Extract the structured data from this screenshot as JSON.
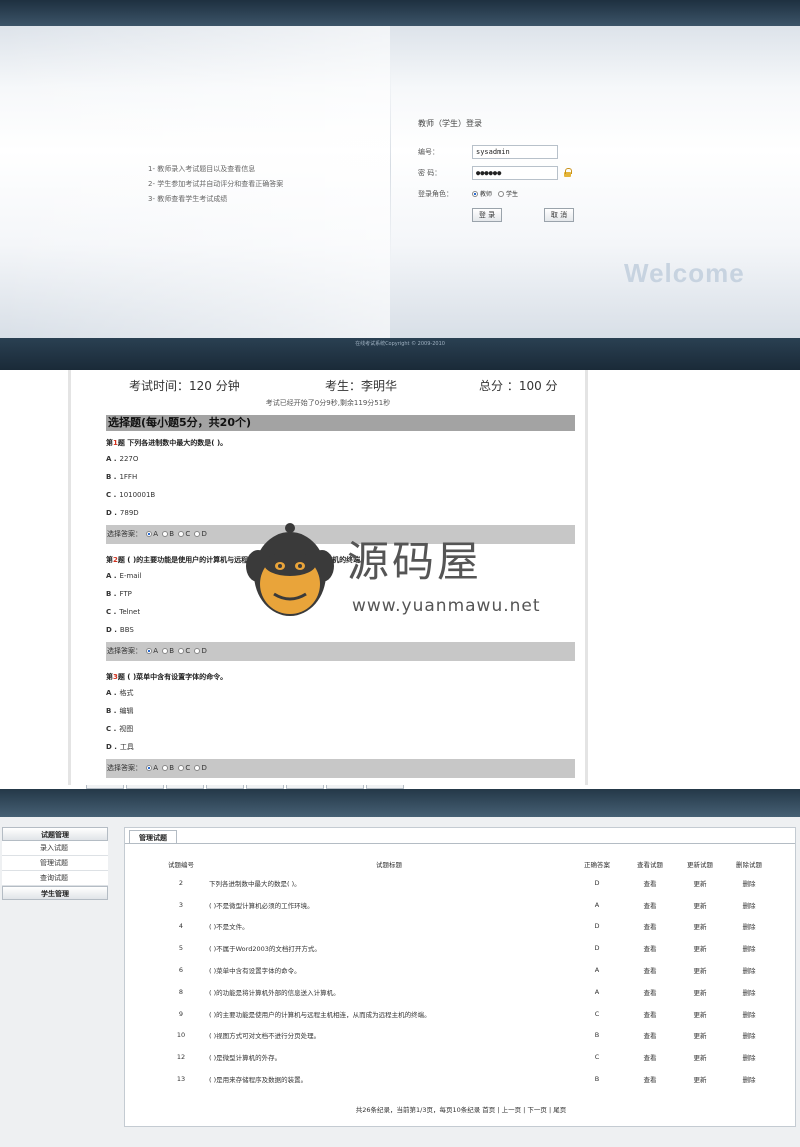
{
  "login": {
    "features": [
      "1- 教师录入考试题目以及查看信息",
      "2- 学生参加考试并自动评分和查看正确答案",
      "3- 教师查看学生考试成绩"
    ],
    "form_title": "教师（学生）登录",
    "username_label": "编号：",
    "username_value": "sysadmin",
    "password_label": "密 码：",
    "password_value": "●●●●●●",
    "role_label": "登录角色：",
    "role_options": [
      "教师",
      "学生"
    ],
    "role_selected": "教师",
    "login_button": "登 录",
    "cancel_button": "取 消",
    "welcome": "Welcome",
    "footer": "在线考试系统Copyright © 2009-2010"
  },
  "exam": {
    "time": "考试时间：120 分钟",
    "student": "考生：李明华",
    "total": "总分 ：100 分",
    "timer": "考试已经开始了0分9秒,剩余119分51秒",
    "section_title": "选择题(每小题5分，共20个)",
    "answer_label": "选择答案：",
    "options_letters": [
      "A",
      "B",
      "C",
      "D"
    ],
    "questions": [
      {
        "prefix": "第",
        "num": "1",
        "suffix": "题 下列各进制数中最大的数是( )。",
        "options": [
          {
            "key": "A .",
            "text": "227O"
          },
          {
            "key": "B .",
            "text": "1FFH"
          },
          {
            "key": "C .",
            "text": "1010001B"
          },
          {
            "key": "D .",
            "text": "789D"
          }
        ]
      },
      {
        "prefix": "第",
        "num": "2",
        "suffix": "题 ( )的主要功能是使用户的计算机与远程主机相连，从而成为远程主机的终端。",
        "options": [
          {
            "key": "A .",
            "text": "E-mail"
          },
          {
            "key": "B .",
            "text": "FTP"
          },
          {
            "key": "C .",
            "text": "Telnet"
          },
          {
            "key": "D .",
            "text": "BBS"
          }
        ]
      },
      {
        "prefix": "第",
        "num": "3",
        "suffix": "题 ( )菜单中含有设置字体的命令。",
        "options": [
          {
            "key": "A .",
            "text": "格式"
          },
          {
            "key": "B .",
            "text": "编辑"
          },
          {
            "key": "C .",
            "text": "视图"
          },
          {
            "key": "D .",
            "text": "工具"
          }
        ]
      }
    ]
  },
  "watermark": {
    "name": "源码屋",
    "url": "www.yuanmawu.net"
  },
  "admin": {
    "sidebar": {
      "header1": "试题管理",
      "items": [
        "录入试题",
        "管理试题",
        "查询试题"
      ],
      "header2": "学生管理"
    },
    "tab": "管理试题",
    "columns": [
      "试题编号",
      "试题标题",
      "正确答案",
      "查看试题",
      "更新试题",
      "删除试题"
    ],
    "rows": [
      {
        "id": "2",
        "title": "下列各进制数中最大的数是( )。",
        "answer": "D",
        "view": "查看",
        "update": "更新",
        "del": "删除"
      },
      {
        "id": "3",
        "title": "( )不是微型计算机必须的工作环境。",
        "answer": "A",
        "view": "查看",
        "update": "更新",
        "del": "删除"
      },
      {
        "id": "4",
        "title": "( )不是文件。",
        "answer": "D",
        "view": "查看",
        "update": "更新",
        "del": "删除"
      },
      {
        "id": "5",
        "title": "( )不属于Word2003的文档打开方式。",
        "answer": "D",
        "view": "查看",
        "update": "更新",
        "del": "删除"
      },
      {
        "id": "6",
        "title": "( )菜单中含有设置字体的命令。",
        "answer": "A",
        "view": "查看",
        "update": "更新",
        "del": "删除"
      },
      {
        "id": "8",
        "title": "( )的功能是将计算机外部的信息送入计算机。",
        "answer": "A",
        "view": "查看",
        "update": "更新",
        "del": "删除"
      },
      {
        "id": "9",
        "title": "( )的主要功能是使用户的计算机与远程主机相连，从而成为远程主机的终端。",
        "answer": "C",
        "view": "查看",
        "update": "更新",
        "del": "删除"
      },
      {
        "id": "10",
        "title": "( )视图方式可对文档不进行分页处理。",
        "answer": "B",
        "view": "查看",
        "update": "更新",
        "del": "删除"
      },
      {
        "id": "12",
        "title": "( )是微型计算机的外存。",
        "answer": "C",
        "view": "查看",
        "update": "更新",
        "del": "删除"
      },
      {
        "id": "13",
        "title": "( )是用来存储程序及数据的装置。",
        "answer": "B",
        "view": "查看",
        "update": "更新",
        "del": "删除"
      }
    ],
    "pager": "共26条纪录，当前第1/3页，每页10条纪录 首页 | 上一页 | 下一页 | 尾页"
  },
  "colors": {
    "header_dark": "#1e3040",
    "section_bar": "#a3a3a3",
    "answer_bar": "#c7c7c7",
    "question_number": "#d0301c",
    "watermark_orange": "#e9a43a"
  }
}
